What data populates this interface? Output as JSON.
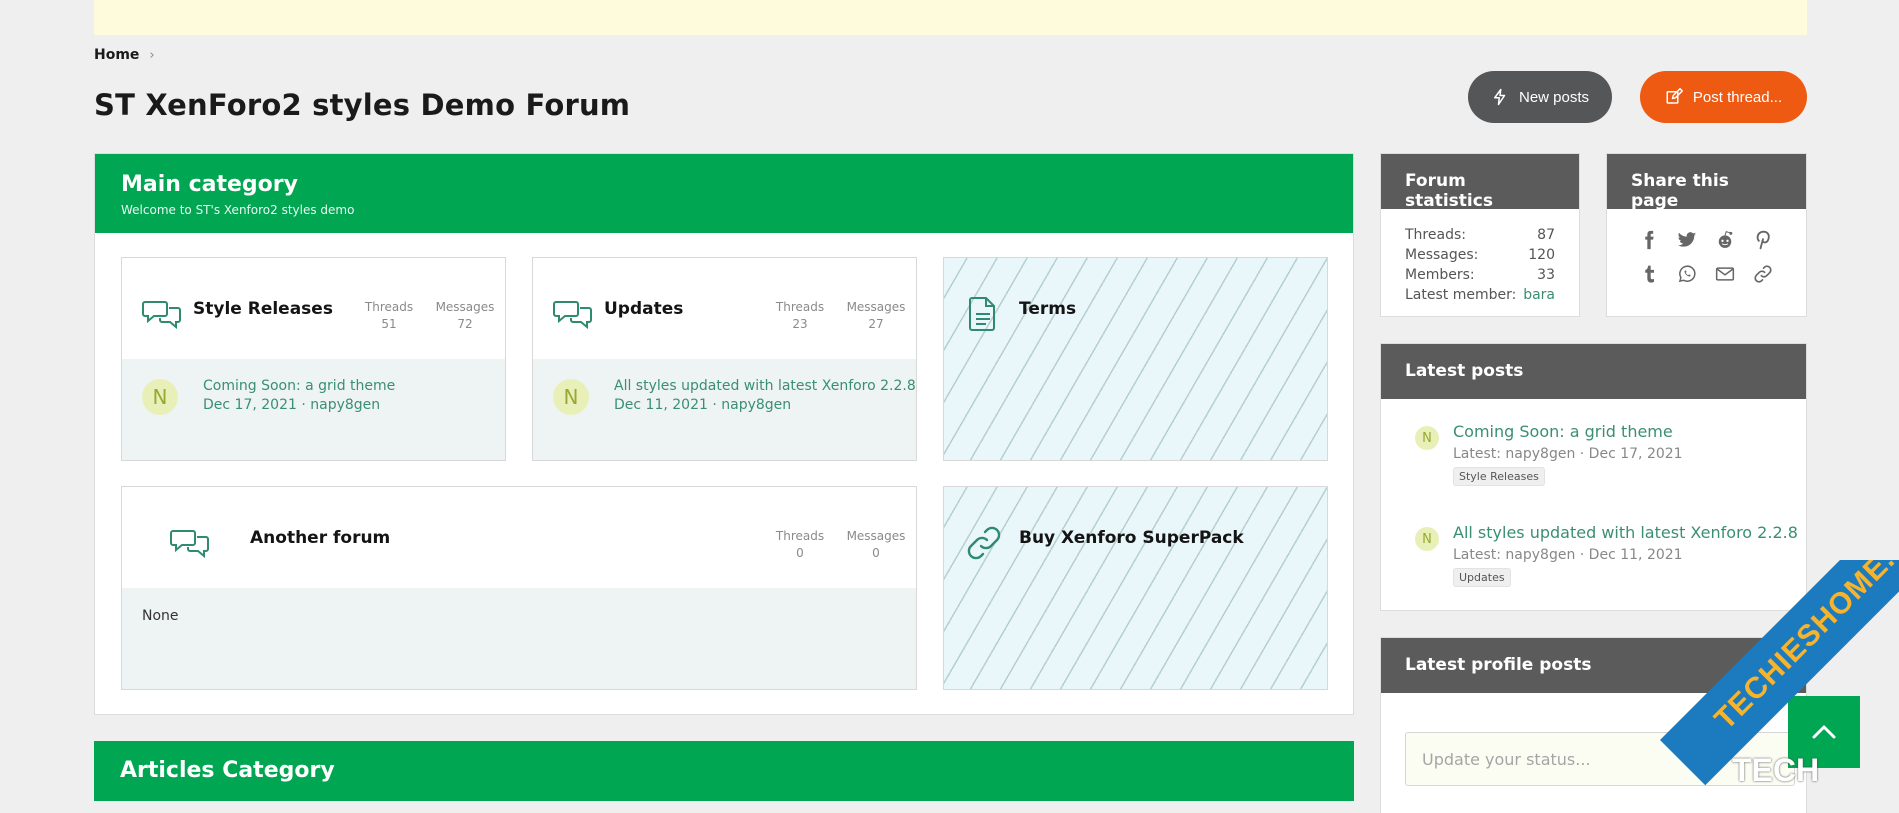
{
  "breadcrumb": {
    "home": "Home"
  },
  "page_title": "ST XenForo2 styles Demo Forum",
  "buttons": {
    "new_posts": "New posts",
    "post_thread": "Post thread..."
  },
  "main_category": {
    "title": "Main category",
    "description": "Welcome to ST's Xenforo2 styles demo",
    "nodes": [
      {
        "title": "Style Releases",
        "threads_label": "Threads",
        "threads": "51",
        "messages_label": "Messages",
        "messages": "72",
        "avatar": "N",
        "last_title": "Coming Soon: a grid theme",
        "last_date": "Dec 17, 2021",
        "last_sep": "·",
        "last_user": "napy8gen"
      },
      {
        "title": "Updates",
        "threads_label": "Threads",
        "threads": "23",
        "messages_label": "Messages",
        "messages": "27",
        "avatar": "N",
        "last_title": "All styles updated with latest Xenforo 2.2.8",
        "last_date": "Dec 11, 2021",
        "last_sep": "·",
        "last_user": "napy8gen"
      },
      {
        "title": "Terms"
      },
      {
        "title": "Another forum",
        "threads_label": "Threads",
        "threads": "0",
        "messages_label": "Messages",
        "messages": "0",
        "none": "None"
      },
      {
        "title": "Buy Xenforo SuperPack"
      }
    ]
  },
  "articles_category": {
    "title": "Articles Category"
  },
  "forum_statistics": {
    "title": "Forum statistics",
    "rows": [
      {
        "label": "Threads:",
        "value": "87"
      },
      {
        "label": "Messages:",
        "value": "120"
      },
      {
        "label": "Members:",
        "value": "33"
      },
      {
        "label": "Latest member:",
        "value": "bara"
      }
    ]
  },
  "share": {
    "title": "Share this page",
    "icons": [
      "facebook-icon",
      "twitter-icon",
      "reddit-icon",
      "pinterest-icon",
      "tumblr-icon",
      "whatsapp-icon",
      "email-icon",
      "link-icon"
    ]
  },
  "latest_posts": {
    "title": "Latest posts",
    "items": [
      {
        "avatar": "N",
        "title": "Coming Soon: a grid theme",
        "meta": "Latest: napy8gen · Dec 17, 2021",
        "tag": "Style Releases"
      },
      {
        "avatar": "N",
        "title": "All styles updated with latest Xenforo 2.2.8",
        "meta": "Latest: napy8gen · Dec 11, 2021",
        "tag": "Updates"
      }
    ]
  },
  "latest_profile_posts": {
    "title": "Latest profile posts",
    "status_placeholder": "Update your status..."
  },
  "watermark": {
    "text": "TECHIESHOME.COM",
    "tech": "TECH"
  },
  "colors": {
    "green": "#00a651",
    "orange": "#ee5a12",
    "dark": "#555657",
    "link": "#3a8f73"
  }
}
